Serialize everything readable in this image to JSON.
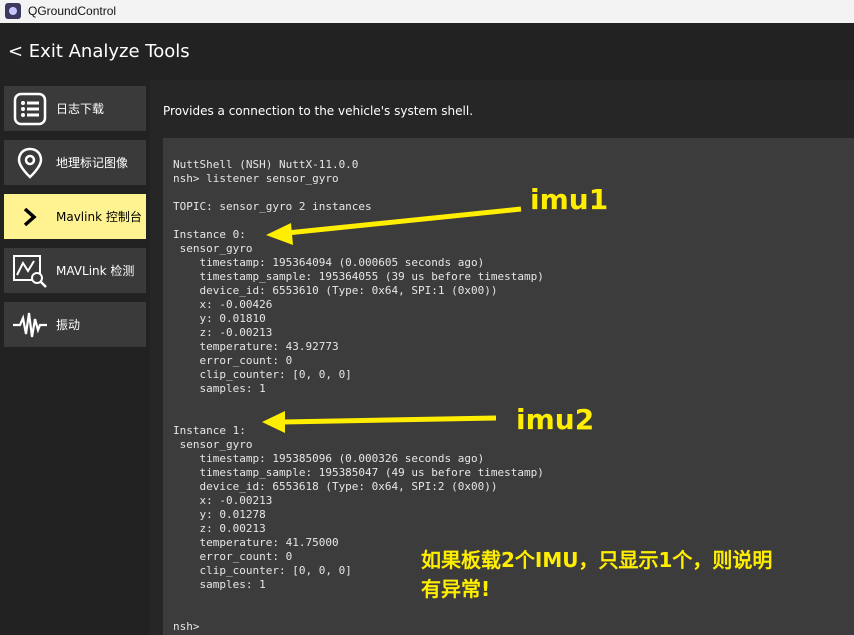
{
  "window": {
    "title": "QGroundControl"
  },
  "header": {
    "back_label": "< Exit Analyze Tools"
  },
  "sidebar": {
    "items": [
      {
        "label": "日志下载",
        "icon": "list-icon",
        "active": false
      },
      {
        "label": "地理标记图像",
        "icon": "map-pin-icon",
        "active": false
      },
      {
        "label": "Mavlink 控制台",
        "icon": "chevron-right-icon",
        "active": true
      },
      {
        "label": "MAVLink 检测",
        "icon": "chart-inspect-icon",
        "active": false
      },
      {
        "label": "振动",
        "icon": "waveform-icon",
        "active": false
      }
    ]
  },
  "main": {
    "description": "Provides a connection to the vehicle's system shell.",
    "console_text": "NuttShell (NSH) NuttX-11.0.0\nnsh> listener sensor_gyro\n\nTOPIC: sensor_gyro 2 instances\n\nInstance 0:\n sensor_gyro\n    timestamp: 195364094 (0.000605 seconds ago)\n    timestamp_sample: 195364055 (39 us before timestamp)\n    device_id: 6553610 (Type: 0x64, SPI:1 (0x00))\n    x: -0.00426\n    y: 0.01810\n    z: -0.00213\n    temperature: 43.92773\n    error_count: 0\n    clip_counter: [0, 0, 0]\n    samples: 1\n\n\nInstance 1:\n sensor_gyro\n    timestamp: 195385096 (0.000326 seconds ago)\n    timestamp_sample: 195385047 (49 us before timestamp)\n    device_id: 6553618 (Type: 0x64, SPI:2 (0x00))\n    x: -0.00213\n    y: 0.01278\n    z: 0.00213\n    temperature: 41.75000\n    error_count: 0\n    clip_counter: [0, 0, 0]\n    samples: 1\n\n\nnsh>"
  },
  "annotations": {
    "imu1_label": "imu1",
    "imu2_label": "imu2",
    "note_line1": "如果板载2个IMU，只显示1个，则说明",
    "note_line2": "有异常!",
    "color": "#ffee00"
  },
  "colors": {
    "background": "#222222",
    "sidebar_item": "#3a3a3a",
    "sidebar_active": "#fff291",
    "console_bg": "#3c3c3c"
  }
}
